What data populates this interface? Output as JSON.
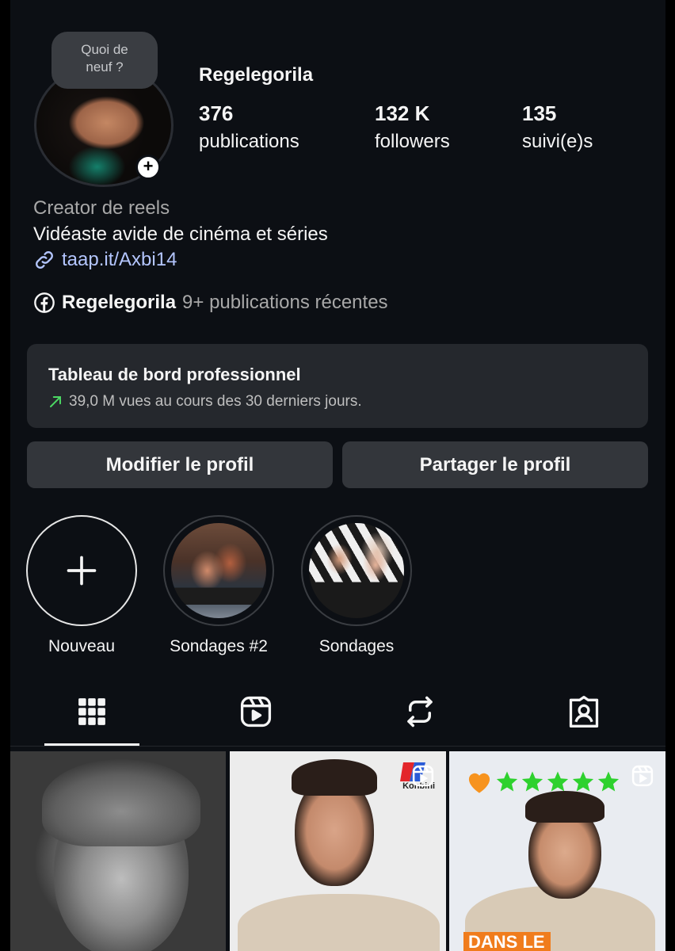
{
  "profile": {
    "note": "Quoi de\nneuf ?",
    "username": "Regelegorila",
    "stats": [
      {
        "value": "376",
        "label": "publications"
      },
      {
        "value": "132 K",
        "label": "followers"
      },
      {
        "value": "135",
        "label": "suivi(e)s"
      }
    ],
    "category": "Creator de reels",
    "bio": "Vidéaste avide de cinéma et séries",
    "link": "taap.it/Axbi14",
    "facebook": {
      "name": "Regelegorila",
      "count": "9+ publications récentes"
    }
  },
  "dashboard": {
    "title": "Tableau de bord professionnel",
    "subtitle": "39,0 M vues au cours des 30 derniers jours."
  },
  "actions": {
    "edit": "Modifier le profil",
    "share": "Partager le profil"
  },
  "highlights": [
    {
      "label": "Nouveau",
      "icon": "plus-icon"
    },
    {
      "label": "Sondages #2"
    },
    {
      "label": "Sondages"
    }
  ],
  "tabs": [
    {
      "icon": "grid-icon",
      "active": true
    },
    {
      "icon": "reels-icon"
    },
    {
      "icon": "repost-icon"
    },
    {
      "icon": "tagged-icon"
    }
  ],
  "grid": {
    "post2_brand": "Konbini",
    "post3_banner": "DANS LE"
  },
  "colors": {
    "background": "#0c0f14",
    "card": "#25282d",
    "button": "#33363b",
    "link": "#b4c6ff",
    "growth_arrow": "#4cd964",
    "star_green": "#2ed12e",
    "heart_orange": "#f7931e"
  }
}
